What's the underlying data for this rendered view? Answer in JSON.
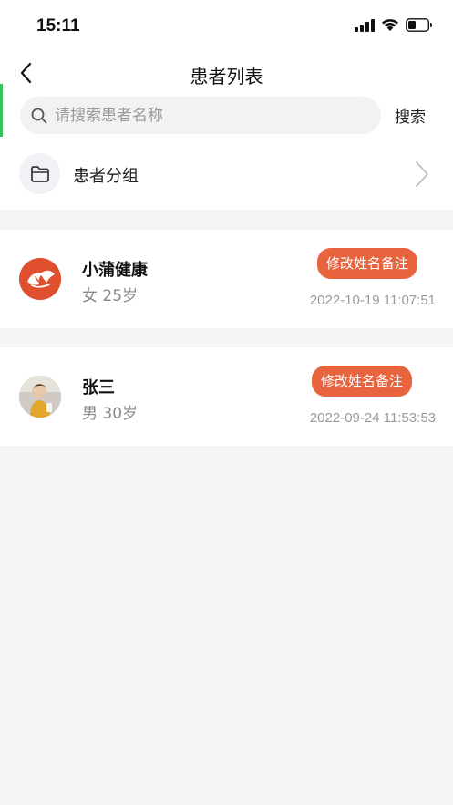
{
  "status_bar": {
    "time": "15:11",
    "icons": [
      "signal-icon",
      "wifi-icon",
      "battery-icon"
    ]
  },
  "nav": {
    "back_icon": "chevron-left-icon",
    "title": "患者列表"
  },
  "search": {
    "placeholder": "请搜索患者名称",
    "value": "",
    "button_label": "搜索",
    "icon": "search-icon"
  },
  "group": {
    "label": "患者分组",
    "icon": "folder-icon",
    "chevron": "chevron-right-icon"
  },
  "patients": [
    {
      "name": "小蒲健康",
      "info": "女 25岁",
      "action_label": "修改姓名备注",
      "time": "2022-10-19 11:07:51",
      "avatar": "brand-logo-avatar"
    },
    {
      "name": "张三",
      "info": "男 30岁",
      "action_label": "修改姓名备注",
      "time": "2022-09-24 11:53:53",
      "avatar": "photo-avatar"
    }
  ],
  "colors": {
    "accent": "#e8643f",
    "marker_green": "#35c35a",
    "background": "#f5f5f5"
  }
}
